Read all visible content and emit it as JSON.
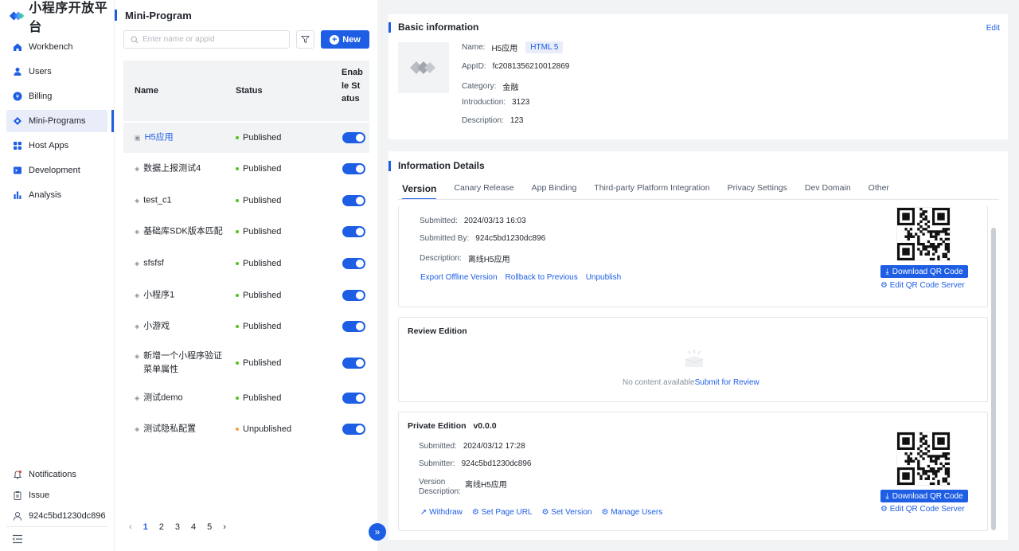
{
  "app": {
    "title": "小程序开放平台"
  },
  "nav": {
    "items": [
      {
        "label": "Workbench",
        "icon": "home-icon"
      },
      {
        "label": "Users",
        "icon": "user-icon"
      },
      {
        "label": "Billing",
        "icon": "billing-icon"
      },
      {
        "label": "Mini-Programs",
        "icon": "diamond-icon"
      },
      {
        "label": "Host Apps",
        "icon": "grid-icon"
      },
      {
        "label": "Development",
        "icon": "terminal-icon"
      },
      {
        "label": "Analysis",
        "icon": "chart-icon"
      }
    ],
    "bottom": [
      {
        "label": "Notifications",
        "icon": "bell-icon"
      },
      {
        "label": "Issue",
        "icon": "clipboard-icon"
      },
      {
        "label": "924c5bd1230dc896",
        "icon": "user-outline-icon"
      }
    ]
  },
  "list": {
    "title": "Mini-Program",
    "search_placeholder": "Enter name or appid",
    "new_label": "New",
    "headers": {
      "name": "Name",
      "status": "Status",
      "enable": "Enable Status"
    },
    "rows": [
      {
        "name": "H5应用",
        "status": "Published",
        "status_color": "#52c41a"
      },
      {
        "name": "数据上报测试4",
        "status": "Published",
        "status_color": "#52c41a"
      },
      {
        "name": "test_c1",
        "status": "Published",
        "status_color": "#52c41a"
      },
      {
        "name": "基础库SDK版本匹配",
        "status": "Published",
        "status_color": "#52c41a"
      },
      {
        "name": "sfsfsf",
        "status": "Published",
        "status_color": "#52c41a"
      },
      {
        "name": "小程序1",
        "status": "Published",
        "status_color": "#52c41a"
      },
      {
        "name": "小游戏",
        "status": "Published",
        "status_color": "#52c41a"
      },
      {
        "name": "新增一个小程序验证菜单属性",
        "status": "Published",
        "status_color": "#52c41a"
      },
      {
        "name": "测试demo",
        "status": "Published",
        "status_color": "#52c41a"
      },
      {
        "name": "测试隐私配置",
        "status": "Unpublished",
        "status_color": "#fa9d3b"
      }
    ],
    "pages": [
      "1",
      "2",
      "3",
      "4",
      "5"
    ],
    "current_page": "1"
  },
  "basic": {
    "title": "Basic information",
    "edit": "Edit",
    "name_label": "Name:",
    "name": "H5应用",
    "tag": "HTML 5",
    "appid_label": "AppID:",
    "appid": "fc2081356210012869",
    "category_label": "Category:",
    "category": "金融",
    "intro_label": "Introduction:",
    "intro": "3123",
    "desc_label": "Description:",
    "desc": "123"
  },
  "details": {
    "title": "Information Details",
    "tabs": [
      "Version",
      "Canary Release",
      "App Binding",
      "Third-party Platform Integration",
      "Privacy Settings",
      "Dev Domain",
      "Other"
    ],
    "online": {
      "submitted_label": "Submitted:",
      "submitted": "2024/03/13 16:03",
      "by_label": "Submitted By:",
      "by": "924c5bd1230dc896",
      "desc_label": "Description:",
      "desc": "离线H5应用",
      "actions": [
        "Export Offline Version",
        "Rollback to Previous",
        "Unpublish"
      ],
      "download": "Download QR Code",
      "edit_qr": "Edit QR Code Server"
    },
    "review": {
      "title": "Review Edition",
      "empty": "No content available",
      "submit": "Submit for Review"
    },
    "private": {
      "title": "Private Edition",
      "version": "v0.0.0",
      "submitted_label": "Submitted:",
      "submitted": "2024/03/12 17:28",
      "submitter_label": "Submitter:",
      "submitter": "924c5bd1230dc896",
      "vdesc_label_1": "Version",
      "vdesc_label_2": "Description:",
      "vdesc": "离线H5应用",
      "actions": [
        "Withdraw",
        "Set Page URL",
        "Set Version",
        "Manage Users"
      ],
      "download": "Download QR Code",
      "edit_qr": "Edit QR Code Server"
    }
  },
  "colors": {
    "primary": "#1d5ee5",
    "published": "#52c41a",
    "unpublished": "#fa9d3b"
  }
}
